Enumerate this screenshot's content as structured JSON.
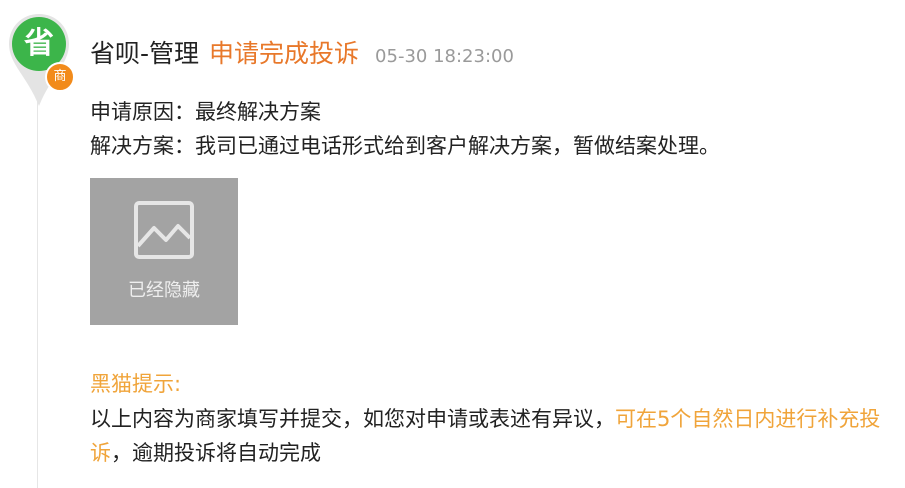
{
  "avatar": {
    "char": "省",
    "badge": "商",
    "color": "#3cb54a",
    "badge_color": "#f28b1b"
  },
  "header": {
    "author": "省呗-管理",
    "action": "申请完成投诉",
    "timestamp": "05-30 18:23:00"
  },
  "content": {
    "reason": "申请原因：最终解决方案",
    "solution": "解决方案：我司已通过电话形式给到客户解决方案，暂做结案处理。"
  },
  "attachment": {
    "icon": "image-icon",
    "label": "已经隐藏"
  },
  "tip": {
    "title": "黑猫提示:",
    "body_prefix": "以上内容为商家填写并提交，如您对申请或表述有异议，",
    "body_highlight": "可在5个自然日内进行补充投诉",
    "body_suffix": "，逾期投诉将自动完成"
  },
  "colors": {
    "accent_orange": "#e8782a",
    "tip_orange": "#f0a43a",
    "timestamp_gray": "#9a9a9a"
  }
}
